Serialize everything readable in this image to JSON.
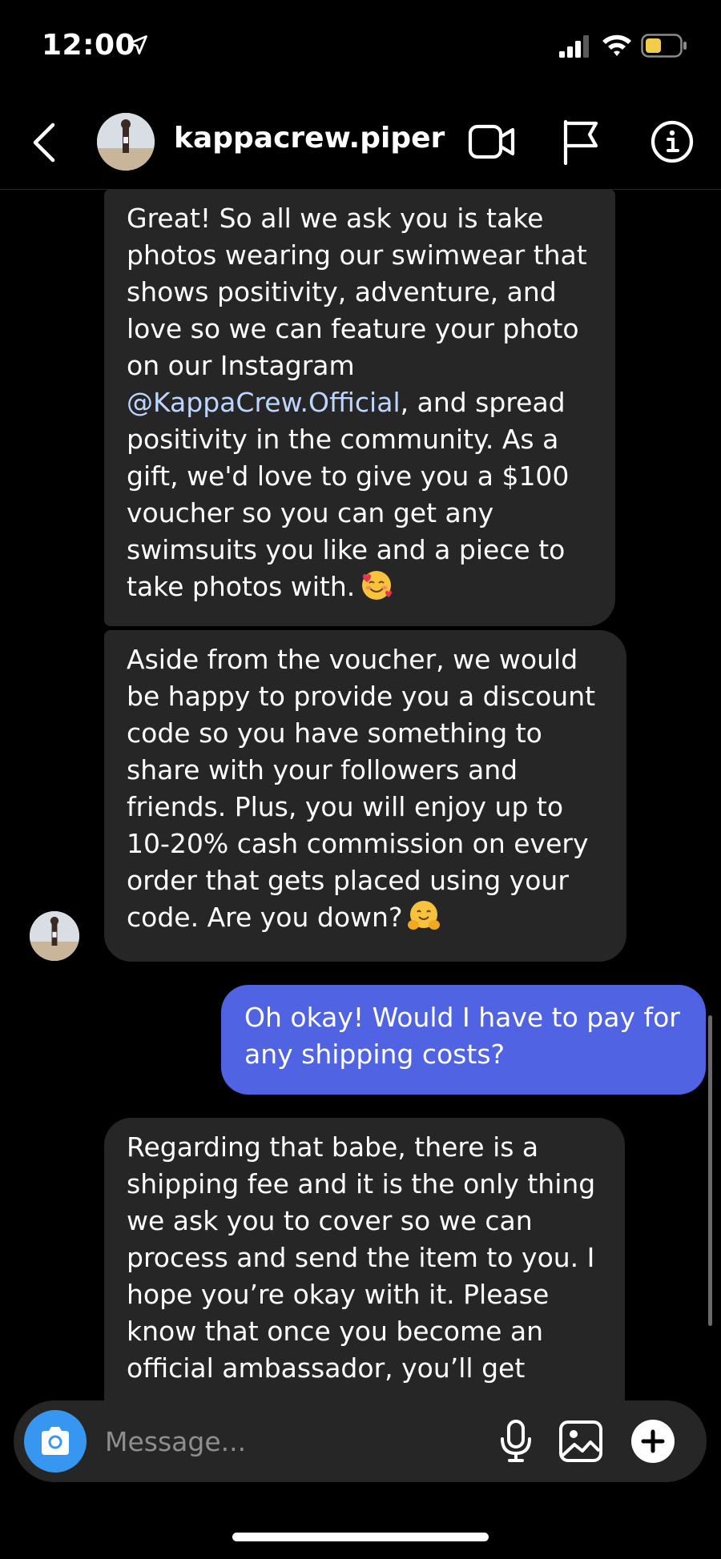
{
  "status_bar": {
    "time": "12:00",
    "icons": [
      "location-arrow-icon",
      "cellular-signal-icon",
      "wifi-icon",
      "battery-icon"
    ],
    "battery_color": "#f2cc4b"
  },
  "header": {
    "username": "kappacrew.piper",
    "icons": [
      "back-icon",
      "avatar",
      "video-call-icon",
      "flag-icon",
      "info-icon"
    ]
  },
  "messages": [
    {
      "direction": "incoming",
      "text_before": "Great! So all we ask you is take photos wearing our swimwear that shows positivity, adventure, and love so we can feature your photo on our Instagram",
      "mention": "@KappaCrew.Official",
      "text_after": ", and spread positivity in the community. As a gift, we'd love to give you a $100 voucher so you can get any swimsuits you like and a piece to take photos with.",
      "emoji": "smiling-face-with-hearts-icon"
    },
    {
      "direction": "incoming",
      "text": "Aside from the voucher, we would be happy to provide you a discount code so you have something to share with your followers and friends. Plus, you will enjoy up to 10-20% cash commission on every order that gets placed using your code. Are you down?",
      "emoji": "hugging-face-icon"
    },
    {
      "direction": "outgoing",
      "text": "Oh okay! Would I have to pay for any shipping costs?"
    },
    {
      "direction": "incoming",
      "text": "Regarding that babe, there is a shipping fee and it is the only thing we ask you to cover so we can process and send the item to you. I hope you’re okay with it. Please know that once you become an official ambassador, you’ll get"
    }
  ],
  "composer": {
    "placeholder": "Message...",
    "icons": [
      "camera-icon",
      "microphone-icon",
      "gallery-icon",
      "plus-icon"
    ]
  },
  "colors": {
    "background": "#000000",
    "incoming_bubble": "#262626",
    "outgoing_bubble": "#4f63e3",
    "mention": "#bcd6ff",
    "camera_button": "#3797f0"
  }
}
